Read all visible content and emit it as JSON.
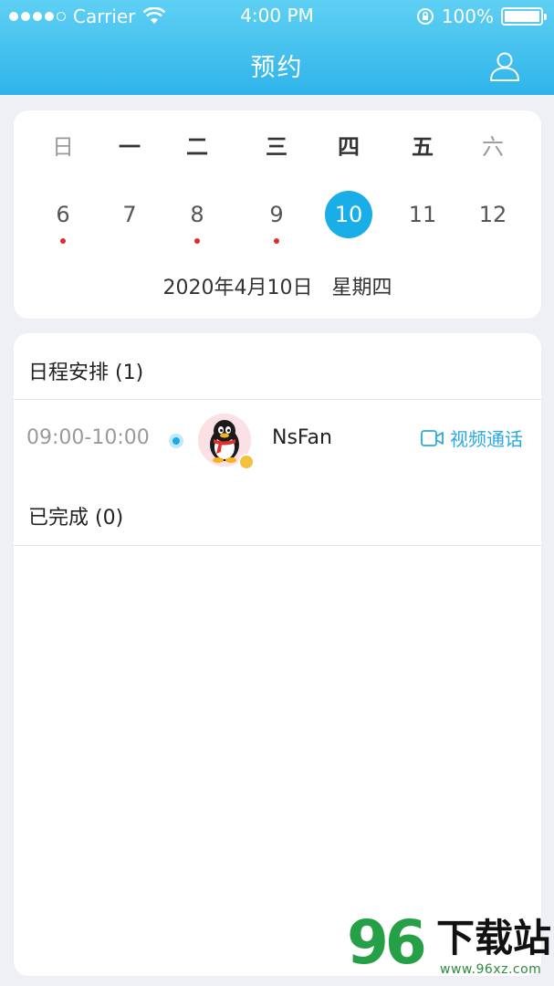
{
  "status_bar": {
    "carrier": "Carrier",
    "time": "4:00 PM",
    "battery": "100%"
  },
  "nav": {
    "title": "预约",
    "profile_icon": "user-icon"
  },
  "calendar": {
    "weekdays": [
      "日",
      "一",
      "二",
      "三",
      "四",
      "五",
      "六"
    ],
    "days": [
      {
        "num": "6",
        "has_event": true
      },
      {
        "num": "7",
        "has_event": false
      },
      {
        "num": "8",
        "has_event": true
      },
      {
        "num": "9",
        "has_event": true
      },
      {
        "num": "10",
        "has_event": false,
        "selected": true
      },
      {
        "num": "11",
        "has_event": false
      },
      {
        "num": "12",
        "has_event": false
      }
    ],
    "full_date": "2020年4月10日   星期四",
    "selected_color": "#19aee8",
    "event_dot_color": "#e02c2c"
  },
  "schedule": {
    "pending_title": "日程安排 (1)",
    "appointments": [
      {
        "time": "09:00-10:00",
        "name": "NsFan",
        "action_label": "视频通话",
        "action_icon": "video-camera-icon"
      }
    ],
    "completed_title": "已完成 (0)"
  },
  "watermark": {
    "number": "96",
    "text": "下载站",
    "url": "www.96xz.com"
  }
}
